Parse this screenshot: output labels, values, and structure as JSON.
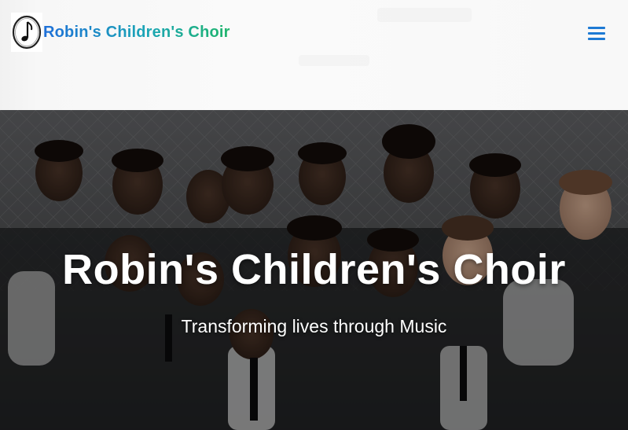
{
  "header": {
    "brand_name": "Robin's Children's Choir",
    "logo_icon": "music-note-icon",
    "menu_icon": "hamburger-menu-icon",
    "brand_gradient": [
      "#1e6fd8",
      "#1ba5b6",
      "#1fb56b"
    ],
    "menu_color": "#1e7ad4"
  },
  "hero": {
    "title": "Robin's Children's Choir",
    "subtitle": "Transforming lives through Music",
    "image_subject": "group-photo-of-choir-children"
  }
}
